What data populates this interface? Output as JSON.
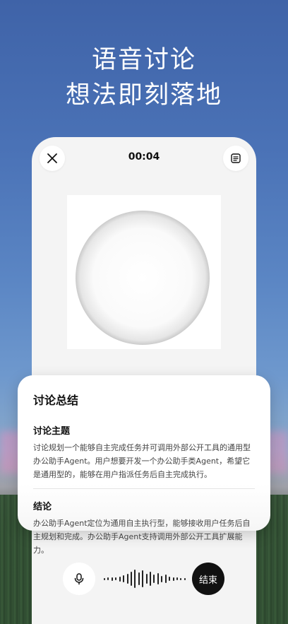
{
  "headline": {
    "line1": "语音讨论",
    "line2": "想法即刻落地"
  },
  "call": {
    "timer": "00:04",
    "close_icon": "close-icon",
    "transcript_icon": "list-document-icon"
  },
  "summary": {
    "title": "讨论总结",
    "sections": [
      {
        "heading": "讨论主题",
        "body": "讨论规划一个能够自主完成任务并可调用外部公开工具的通用型办公助手Agent。用户想要开发一个办公助手类Agent，希望它是通用型的，能够在用户指派任务后自主完成执行。"
      },
      {
        "heading": "结论",
        "body": "办公助手Agent定位为通用自主执行型，能够接收用户任务后自主规划和完成。办公助手Agent支持调用外部公开工具扩展能力。"
      }
    ]
  },
  "controls": {
    "mic_icon": "microphone-icon",
    "end_label": "结束"
  },
  "colors": {
    "accent": "#111111",
    "card": "#ffffff",
    "sky": "#4b73b7"
  }
}
